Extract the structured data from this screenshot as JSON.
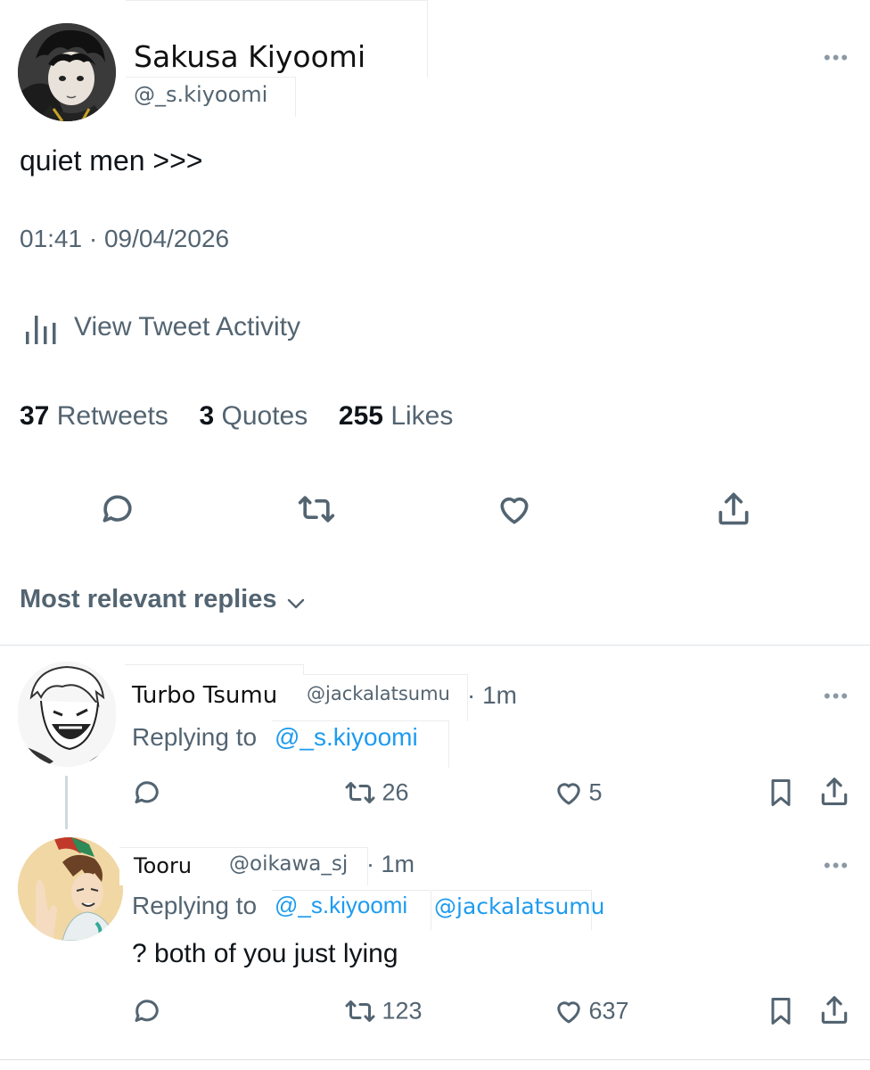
{
  "main_tweet": {
    "display_name": "Sakusa Kiyoomi",
    "handle": "@_s.kiyoomi",
    "text": "quiet men >>>",
    "timestamp": "01:41 · 09/04/2026",
    "activity_label": "View Tweet Activity",
    "stats": {
      "retweets_count": "37",
      "retweets_label": "Retweets",
      "quotes_count": "3",
      "quotes_label": "Quotes",
      "likes_count": "255",
      "likes_label": "Likes"
    },
    "actions": [
      "reply-icon",
      "retweet-icon",
      "like-icon",
      "share-icon"
    ]
  },
  "replies_sort": {
    "label": "Most relevant replies"
  },
  "replies": [
    {
      "display_name": "Turbo Tsumu",
      "handle": "@jackalatsumu",
      "time": "· 1m",
      "replying_prefix": "Replying to",
      "mentions": [
        "@_s.kiyoomi"
      ],
      "text": "",
      "retweets": "26",
      "likes": "5"
    },
    {
      "display_name": "Tooru",
      "handle": "@oikawa_sj",
      "time": "· 1m",
      "replying_prefix": "Replying to",
      "mentions": [
        "@_s.kiyoomi",
        "@jackalatsumu"
      ],
      "text": "? both of you just lying",
      "retweets": "123",
      "likes": "637"
    }
  ],
  "colors": {
    "text": "#0f1419",
    "secondary": "#536471",
    "link": "#1d9bf0",
    "divider": "#dfe3e6"
  }
}
